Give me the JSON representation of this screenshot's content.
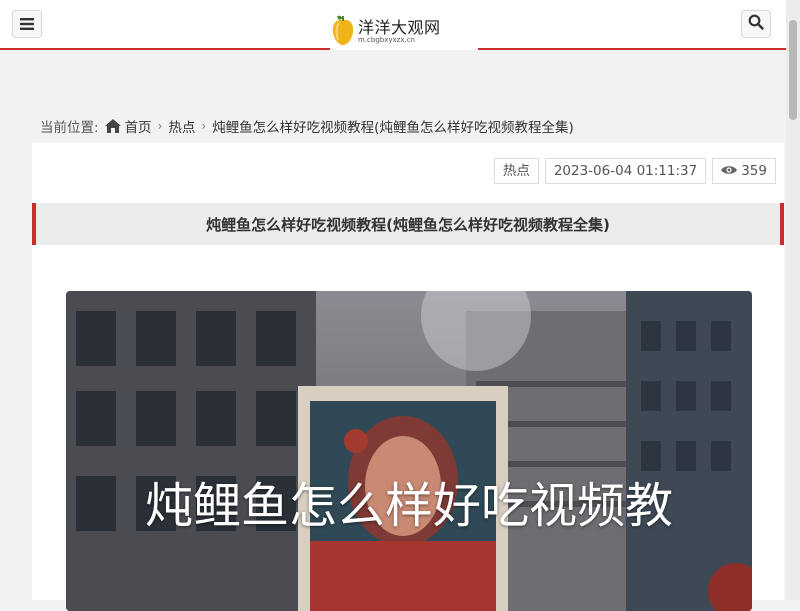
{
  "header": {
    "site_name": "洋洋大观网",
    "site_domain": "m.cbgbxyxzx.cn",
    "accent_color": "#c9302c",
    "menu_icon": "hamburger-menu-icon",
    "search_icon": "search-icon"
  },
  "breadcrumb": {
    "prefix": "当前位置:",
    "home": "首页",
    "category": "热点",
    "current": "炖鲤鱼怎么样好吃视频教程(炖鲤鱼怎么样好吃视频教程全集)"
  },
  "article": {
    "category_tag": "热点",
    "date": "2023-06-04 01:11:37",
    "views": "359",
    "title": "炖鲤鱼怎么样好吃视频教程(炖鲤鱼怎么样好吃视频教程全集)",
    "image_caption": "炖鲤鱼怎么样好吃视频教"
  }
}
